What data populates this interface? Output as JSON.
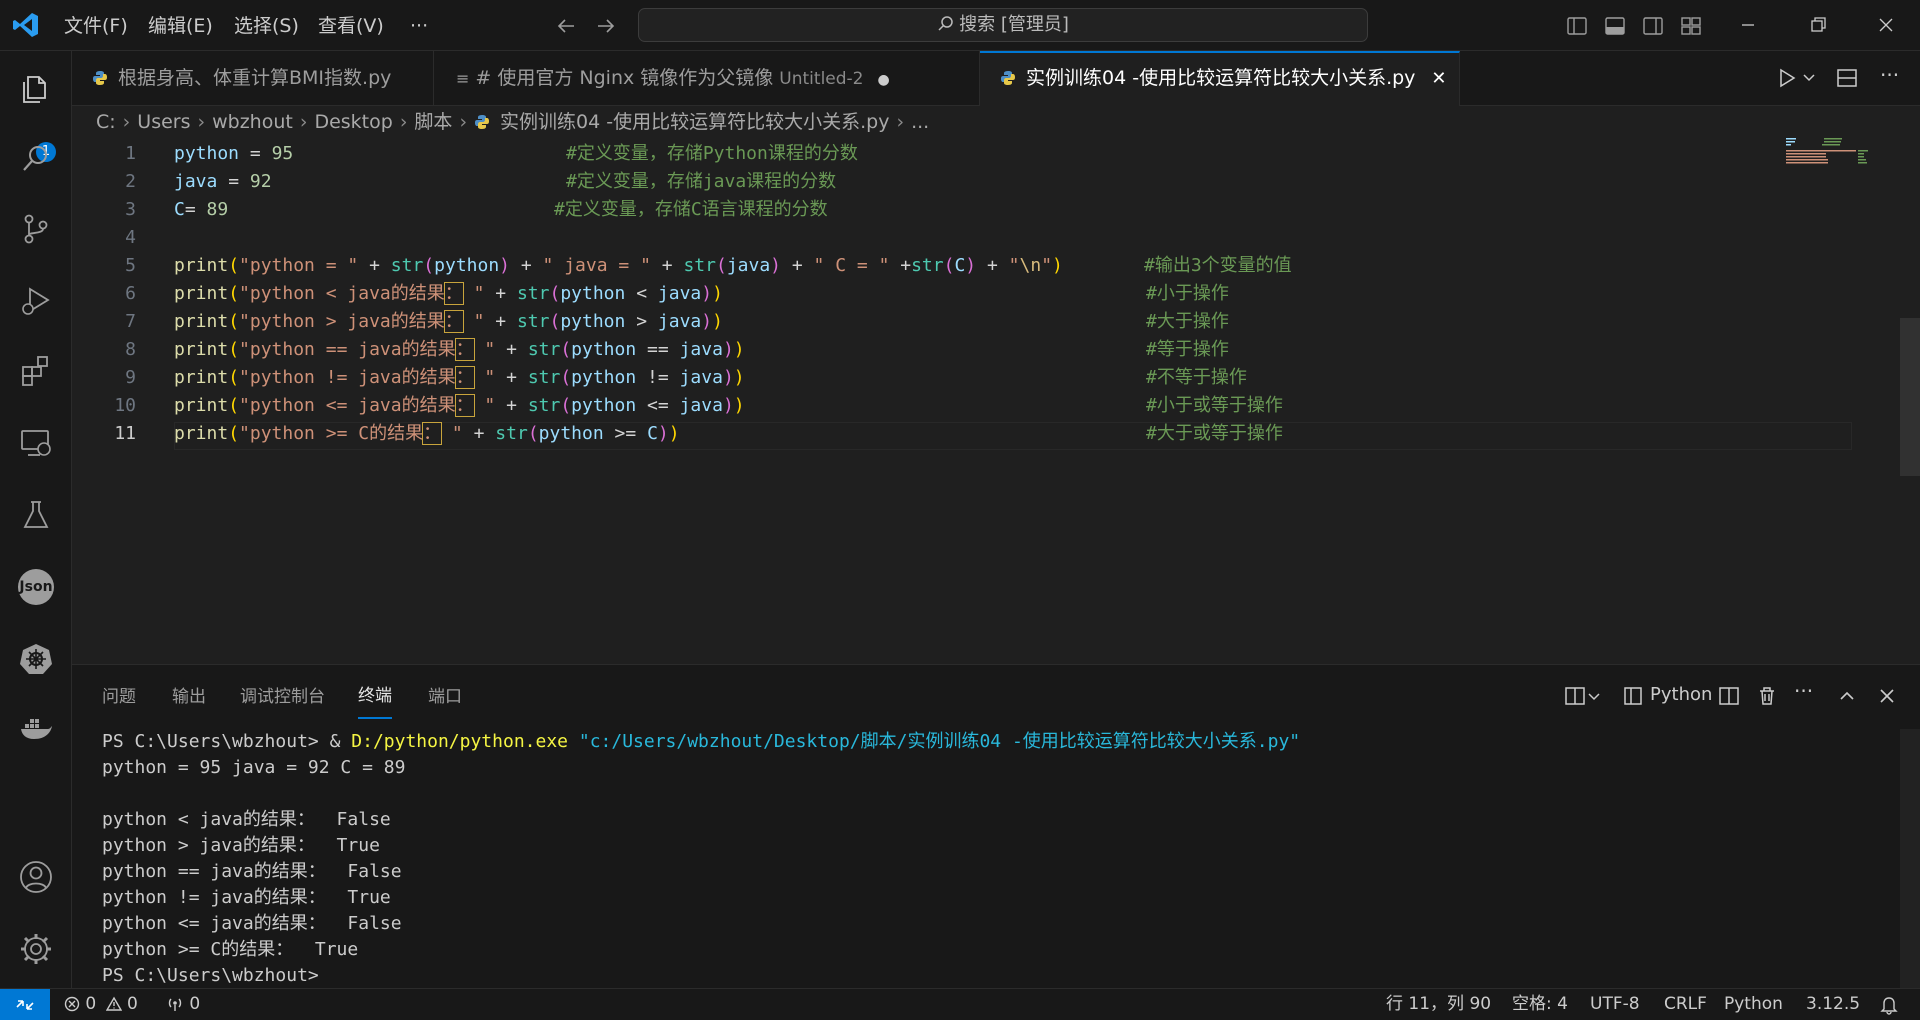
{
  "menu": {
    "file": "文件(F)",
    "edit": "编辑(E)",
    "select": "选择(S)",
    "view": "查看(V)",
    "more": "···"
  },
  "search": {
    "label": "搜索 [管理员]"
  },
  "activity": {
    "explorer_badge": "1",
    "json_label": "Json"
  },
  "tabs": [
    {
      "label": "根据身高、体重计算BMI指数.py",
      "sub": ""
    },
    {
      "label": "# 使用官方 Nginx 镜像作为父镜像",
      "sub": "Untitled-2",
      "dirty": "●"
    },
    {
      "label": "实例训练04 -使用比较运算符比较大小关系.py",
      "close": "✕"
    }
  ],
  "breadcrumb": [
    "C:",
    "Users",
    "wbzhout",
    "Desktop",
    "脚本",
    "实例训练04 -使用比较运算符比较大小关系.py",
    "..."
  ],
  "editor": {
    "line_numbers": [
      "1",
      "2",
      "3",
      "4",
      "5",
      "6",
      "7",
      "8",
      "9",
      "10",
      "11"
    ],
    "lines": [
      {
        "code": "python = 95",
        "comment": "#定义变量，存储Python课程的分数"
      },
      {
        "code": "java = 92",
        "comment": "#定义变量，存储java课程的分数"
      },
      {
        "code": "C= 89",
        "comment": "#定义变量，存储C语言课程的分数"
      },
      {
        "code": "",
        "comment": ""
      },
      {
        "code": "print(\"python = \" + str(python) + \" java = \" + str(java) + \" C = \" +str(C) + \"\\n\")",
        "comment": "#输出3个变量的值"
      },
      {
        "code": "print(\"python < java的结果： \" + str(python < java))",
        "comment": "#小于操作"
      },
      {
        "code": "print(\"python > java的结果： \" + str(python > java))",
        "comment": "#大于操作"
      },
      {
        "code": "print(\"python == java的结果： \" + str(python == java))",
        "comment": "#等于操作"
      },
      {
        "code": "print(\"python != java的结果： \" + str(python != java))",
        "comment": "#不等于操作"
      },
      {
        "code": "print(\"python <= java的结果： \" + str(python <= java))",
        "comment": "#小于或等于操作"
      },
      {
        "code": "print(\"python >= C的结果： \" + str(python >= C))",
        "comment": "#大于或等于操作"
      }
    ]
  },
  "panel": {
    "tabs": [
      "问题",
      "输出",
      "调试控制台",
      "终端",
      "端口"
    ],
    "active_tab": "终端",
    "terminal_label": "Python",
    "terminal": {
      "prompt1": "PS C:\\Users\\wbzhout> ",
      "cmd_amp": "& ",
      "cmd_exe": "D:/python/python.exe",
      "cmd_arg": " \"c:/Users/wbzhout/Desktop/脚本/实例训练04 -使用比较运算符比较大小关系.py\"",
      "output": [
        "python = 95 java = 92 C = 89",
        "",
        "python < java的结果：  False",
        "python > java的结果：  True",
        "python == java的结果：  False",
        "python != java的结果：  True",
        "python <= java的结果：  False",
        "python >= C的结果：  True"
      ],
      "prompt_end": "PS C:\\Users\\wbzhout>"
    }
  },
  "status": {
    "errors": "0",
    "warnings": "0",
    "ports": "0",
    "position": "行 11，列 90",
    "spaces": "空格: 4",
    "encoding": "UTF-8",
    "eol": "CRLF",
    "language": "Python",
    "version": "3.12.5"
  },
  "colors": {
    "accent": "#0078d4",
    "bg": "#1f1f1f",
    "chrome": "#181818"
  }
}
